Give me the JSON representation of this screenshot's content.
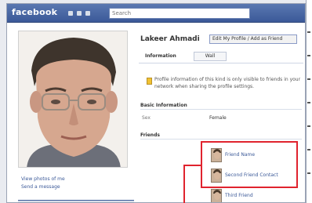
{
  "header": {
    "logo": "facebook",
    "search_value": "Search"
  },
  "profile": {
    "name": "Lakeer Ahmadi",
    "header_button": "Edit My Profile / Add as Friend",
    "photo_lines": [
      "View photos of me",
      "Send a message"
    ]
  },
  "tabs": {
    "active": "Information",
    "other": "Wall"
  },
  "notice": {
    "text": "Profile information of this kind is only visible to friends in your network when sharing the profile settings."
  },
  "sections": {
    "basic_title": "Basic Information",
    "basic_label": "Sex",
    "basic_value": "Female",
    "friends_title": "Friends"
  },
  "friends": [
    {
      "label": "Friend Name"
    },
    {
      "label": "Second Friend Contact"
    },
    {
      "label": "Third Friend"
    }
  ],
  "colors": {
    "brand": "#3b5998",
    "highlight": "#e0232e"
  }
}
